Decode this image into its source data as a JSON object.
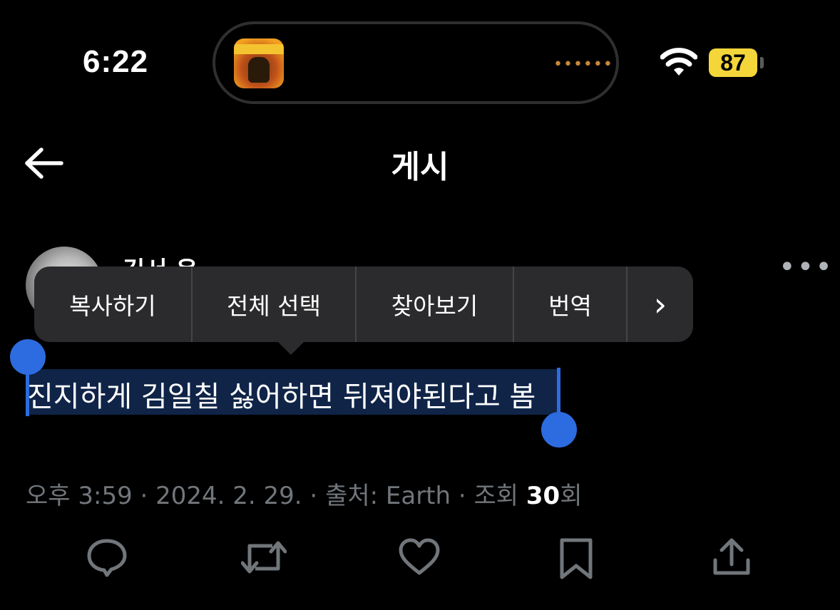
{
  "status_bar": {
    "time": "6:22",
    "battery": "87",
    "battery_color": "#f5d63a",
    "wifi_icon": "wifi-icon"
  },
  "header": {
    "title": "게시",
    "back_icon": "arrow-left-icon"
  },
  "author": {
    "name": "김서 윤"
  },
  "context_menu": {
    "items": [
      {
        "label": "복사하기"
      },
      {
        "label": "전체 선택"
      },
      {
        "label": "찾아보기"
      },
      {
        "label": "번역"
      },
      {
        "label": "›"
      }
    ],
    "background": "#2b2b2d"
  },
  "post": {
    "text": "진지하게 김일칠 싫어하면 뒤져야된다고 봄",
    "selection_color": "#2d6ce0"
  },
  "meta": {
    "time": "오후 3:59",
    "separator": " · ",
    "date": "2024. 2. 29.",
    "source": "출처: Earth",
    "views_prefix": "조회 ",
    "views_count": "30",
    "views_suffix": "회"
  },
  "actions": [
    {
      "name": "reply-icon"
    },
    {
      "name": "retweet-icon"
    },
    {
      "name": "like-icon"
    },
    {
      "name": "bookmark-icon"
    },
    {
      "name": "share-icon"
    }
  ]
}
